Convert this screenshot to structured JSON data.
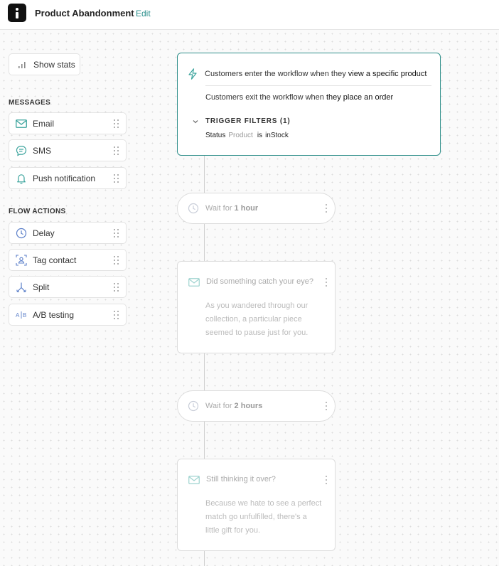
{
  "header": {
    "title": "Product Abandonment",
    "edit_label": "Edit"
  },
  "sidebar": {
    "show_stats_label": "Show stats",
    "messages_heading": "MESSAGES",
    "messages": [
      {
        "label": "Email",
        "icon": "envelope-icon"
      },
      {
        "label": "SMS",
        "icon": "chat-bubble-icon"
      },
      {
        "label": "Push notification",
        "icon": "bell-icon"
      }
    ],
    "flow_actions_heading": "FLOW ACTIONS",
    "flow_actions": [
      {
        "label": "Delay",
        "icon": "clock-icon"
      },
      {
        "label": "Tag contact",
        "icon": "tag-contact-icon"
      },
      {
        "label": "Split",
        "icon": "split-icon"
      },
      {
        "label": "A/B testing",
        "icon": "ab-testing-icon"
      }
    ]
  },
  "trigger": {
    "enter_prefix": "Customers enter the workflow when they ",
    "enter_condition": "view a specific product",
    "exit_prefix": "Customers exit the workflow when ",
    "exit_condition": "they place an order",
    "filters_heading": "TRIGGER FILTERS (1)",
    "filter": {
      "field": "Status",
      "entity": "Product",
      "operator": "is",
      "value": "inStock"
    }
  },
  "steps": [
    {
      "type": "wait",
      "prefix": "Wait for ",
      "duration": "1 hour"
    },
    {
      "type": "email",
      "subject": "Did something catch your eye?",
      "body": "As you wandered through our collection, a particular piece seemed to pause just for you."
    },
    {
      "type": "wait",
      "prefix": "Wait for ",
      "duration": "2 hours"
    },
    {
      "type": "email",
      "subject": "Still thinking it over?",
      "body": "Because we hate to see a perfect match go unfulfilled, there's a little gift for you."
    }
  ],
  "colors": {
    "accent": "#2f8f8a",
    "edit_link": "#2a8f8c",
    "icon_teal": "#3aa39c",
    "icon_blue": "#5b7fc9"
  }
}
